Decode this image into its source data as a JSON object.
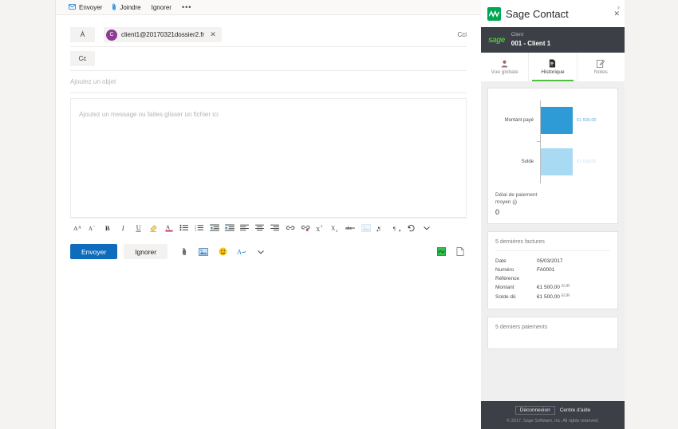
{
  "compose": {
    "commands": [
      {
        "label": "Envoyer",
        "icon": "send-icon"
      },
      {
        "label": "Joindre",
        "icon": "paperclip-icon"
      },
      {
        "label": "Ignorer",
        "icon": "none"
      }
    ],
    "overflow_label": "•••",
    "to_label": "À",
    "cci_label": "Cci",
    "cc_label": "Cc",
    "recipient": {
      "email": "client1@20170321dossier2.fr",
      "avatar_initial": "C",
      "avatar_color": "#8e3a96",
      "remove_label": "✕"
    },
    "subject_placeholder": "Ajoutez un objet",
    "body_placeholder": "Ajoutez un message ou faites glisser un fichier ici",
    "send_button": "Envoyer",
    "discard_button": "Ignorer",
    "format_tools": [
      "increase-font-size-icon",
      "decrease-font-size-icon",
      "bold-icon",
      "italic-icon",
      "underline-icon",
      "highlight-icon",
      "font-color-icon",
      "bulleted-list-icon",
      "numbered-list-icon",
      "decrease-indent-icon",
      "increase-indent-icon",
      "align-left-icon",
      "align-center-icon",
      "align-right-icon",
      "insert-link-icon",
      "remove-link-icon",
      "superscript-icon",
      "subscript-icon",
      "strikethrough-icon",
      "insert-image-icon",
      "ltr-direction-icon",
      "rtl-direction-icon",
      "undo-icon",
      "more-formatting-icon"
    ],
    "send_row_icons": [
      "attach-file-icon",
      "insert-picture-icon",
      "emoji-icon",
      "signature-icon",
      "more-options-icon"
    ],
    "addin_icons": [
      "sage-addin-icon",
      "document-addin-icon"
    ]
  },
  "sage": {
    "app_title": "Sage Contact",
    "logo_text": "sage",
    "close_label": "✕",
    "collapse_label": "›",
    "client": {
      "label": "Client",
      "value": "001 - Client 1"
    },
    "tabs": [
      {
        "label": "Vue globale",
        "icon": "person-icon",
        "active": false
      },
      {
        "label": "Historique",
        "icon": "history-document-icon",
        "active": true
      },
      {
        "label": "Notes",
        "icon": "notes-pencil-icon",
        "active": false
      }
    ],
    "kpi": {
      "label_line1": "Délai de paiement",
      "label_line2": "moyen (j)",
      "value": "0"
    },
    "invoices": {
      "title": "5 dernières factures",
      "rows": [
        {
          "key": "Date",
          "value": "05/03/2017",
          "currency": ""
        },
        {
          "key": "Numéro",
          "value": "FA0001",
          "currency": ""
        },
        {
          "key": "Référence",
          "value": "",
          "currency": ""
        },
        {
          "key": "Montant",
          "value": "€1 500,00",
          "currency": "EUR"
        },
        {
          "key": "Solde dû",
          "value": "€1 500,00",
          "currency": "EUR"
        }
      ]
    },
    "payments": {
      "title": "5 derniers paiements"
    },
    "footer": {
      "logout": "Déconnexion",
      "help": "Centre d'aide",
      "copyright": "© 2017, Sage Software, Inc. All rights reserved."
    }
  },
  "chart_data": {
    "type": "bar",
    "orientation": "horizontal",
    "title": "",
    "categories": [
      "Montant payé",
      "Solde"
    ],
    "values": [
      1500,
      1500
    ],
    "value_labels": [
      "€1 500,00",
      "€1 500,00"
    ],
    "colors": [
      "#2e9bd6",
      "#a9daf4"
    ],
    "label_colors": [
      "#5aa9dc",
      "#bfe0f4"
    ],
    "xlabel": "",
    "ylabel": "",
    "grid": false,
    "legend": "none",
    "xlim": [
      0,
      1700
    ]
  }
}
